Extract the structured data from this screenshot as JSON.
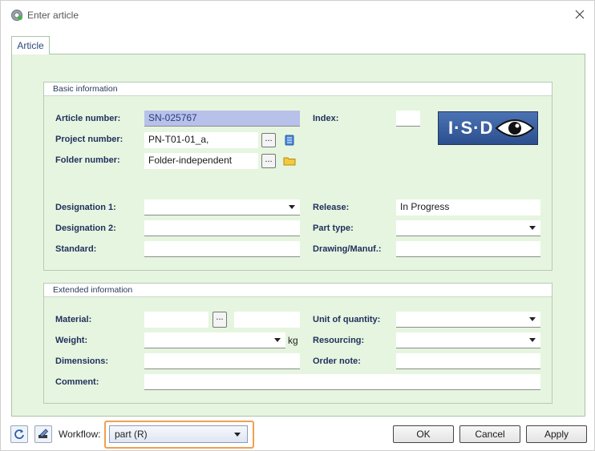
{
  "window": {
    "title": "Enter article"
  },
  "tabs": [
    {
      "label": "Article"
    }
  ],
  "basic": {
    "title": "Basic information",
    "article_number_label": "Article number:",
    "article_number_value": "SN-025767",
    "index_label": "Index:",
    "index_value": "",
    "project_number_label": "Project number:",
    "project_number_value": "PN-T01-01_a,",
    "folder_number_label": "Folder number:",
    "folder_number_value": "Folder-independent",
    "browse_label": "...",
    "designation1_label": "Designation 1:",
    "designation1_value": "",
    "designation2_label": "Designation 2:",
    "designation2_value": "",
    "standard_label": "Standard:",
    "standard_value": "",
    "release_label": "Release:",
    "release_value": "In Progress",
    "part_type_label": "Part type:",
    "part_type_value": "",
    "drawing_label": "Drawing/Manuf.:",
    "drawing_value": "",
    "logo_text": "I·S·D"
  },
  "extended": {
    "title": "Extended information",
    "material_label": "Material:",
    "material_value": "",
    "material_value2": "",
    "browse_label": "...",
    "weight_label": "Weight:",
    "weight_value": "",
    "weight_unit": "kg",
    "dimensions_label": "Dimensions:",
    "dimensions_value": "",
    "comment_label": "Comment:",
    "comment_value": "",
    "unit_of_quantity_label": "Unit of quantity:",
    "unit_of_quantity_value": "",
    "resourcing_label": "Resourcing:",
    "resourcing_value": "",
    "order_note_label": "Order note:",
    "order_note_value": ""
  },
  "footer": {
    "workflow_label": "Workflow:",
    "workflow_value": "part (R)",
    "ok_label": "OK",
    "cancel_label": "Cancel",
    "apply_label": "Apply"
  },
  "colors": {
    "panel_bg": "#e6f5df",
    "label_text": "#1f2f5c",
    "selection_bg": "#b7c1ea",
    "workflow_highlight": "#f0a050"
  }
}
